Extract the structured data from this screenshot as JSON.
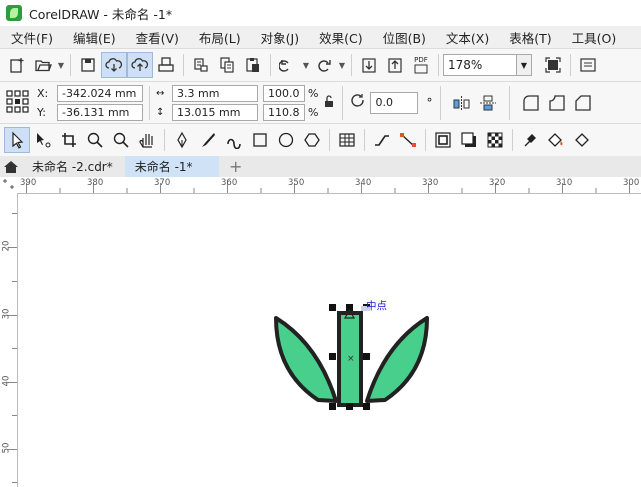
{
  "app": {
    "title": "CorelDRAW - 未命名 -1*"
  },
  "menu": [
    "文件(F)",
    "编辑(E)",
    "查看(V)",
    "布局(L)",
    "对象(J)",
    "效果(C)",
    "位图(B)",
    "文本(X)",
    "表格(T)",
    "工具(O)"
  ],
  "toolbar": {
    "pdf_label": "PDF",
    "zoom": "178%"
  },
  "properties": {
    "x_label": "X:",
    "x_value": "-342.024 mm",
    "y_label": "Y:",
    "y_value": "-36.131 mm",
    "width_value": "3.3 mm",
    "height_value": "13.015 mm",
    "scale_x": "100.0",
    "scale_y": "110.8",
    "percent": "%",
    "rotation": "0.0",
    "degree": "°"
  },
  "tabs": [
    {
      "label": "未命名 -2.cdr*"
    },
    {
      "label": "未命名 -1*"
    }
  ],
  "rulers": {
    "top": [
      "390",
      "380",
      "370",
      "360",
      "350",
      "340",
      "330",
      "320",
      "310",
      "300"
    ],
    "left": [
      "20",
      "30",
      "40",
      "50"
    ]
  },
  "canvas": {
    "snap_label": "中点"
  },
  "colors": {
    "fill": "#47cf8b",
    "stroke": "#222222",
    "snap_text": "#1a1ac8",
    "active_tab": "#cfe2f6"
  }
}
